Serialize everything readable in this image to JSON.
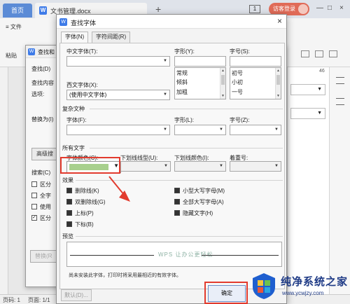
{
  "titlebar": {
    "home_tab": "首页",
    "doc_tab": "文书管理.docx",
    "page_badge": "1",
    "visitor_button": "访客登录"
  },
  "ribbon": {
    "file_menu": "文件",
    "paste_label": "粘贴"
  },
  "right_ruler_number": "46",
  "statusbar": {
    "page": "页码: 1",
    "pages": "页面: 1/1"
  },
  "find_replace": {
    "title": "查找和",
    "tab_find": "查找(D)",
    "find_content_label": "查找内容",
    "options_label": "选项:",
    "replace_label": "替换为(I)",
    "advanced_button": "高级搜",
    "search_label": "搜索(C)",
    "check1": "区分",
    "check2": "全字",
    "check3": "使用",
    "check4": "区分",
    "replace_all_button": "替换(R"
  },
  "font_dialog": {
    "title": "查找字体",
    "tabs": [
      "字体(N)",
      "字符间距(R)"
    ],
    "chinese_font_label": "中文字体(T):",
    "style_label": "字形(Y):",
    "size_label": "字号(S):",
    "western_font_label": "西文字体(X):",
    "western_font_value": "(使用中文字体)",
    "style_options": [
      "常规",
      "倾斜",
      "加粗"
    ],
    "size_options": [
      "初号",
      "小初",
      "一号"
    ],
    "complex_section": "复杂文种",
    "complex_font_label": "字体(F):",
    "complex_style_label": "字形(L):",
    "complex_size_label": "字号(Z):",
    "all_text_section": "所有文字",
    "font_color_label": "字体颜色(C):",
    "font_color_value": "#a8d08d",
    "underline_type_label": "下划线线型(U):",
    "underline_color_label": "下划线颜色(I):",
    "emphasis_label": "着重号:",
    "effects_section": "效果",
    "effects_left": [
      "删除线(K)",
      "双删除线(G)",
      "上标(P)",
      "下标(B)"
    ],
    "effects_right": [
      "小型大写字母(M)",
      "全部大写字母(A)",
      "隐藏文字(H)"
    ],
    "preview_section": "预览",
    "preview_text": "WPS 让办公更轻松",
    "note": "尚未安装此字体，打印时将采用最相近的有效字体。",
    "default_button": "默认(D)...",
    "ok_button": "确定"
  },
  "watermark": {
    "brand_title": "纯净系统之家",
    "brand_url": "www.ycwjzy.com"
  }
}
